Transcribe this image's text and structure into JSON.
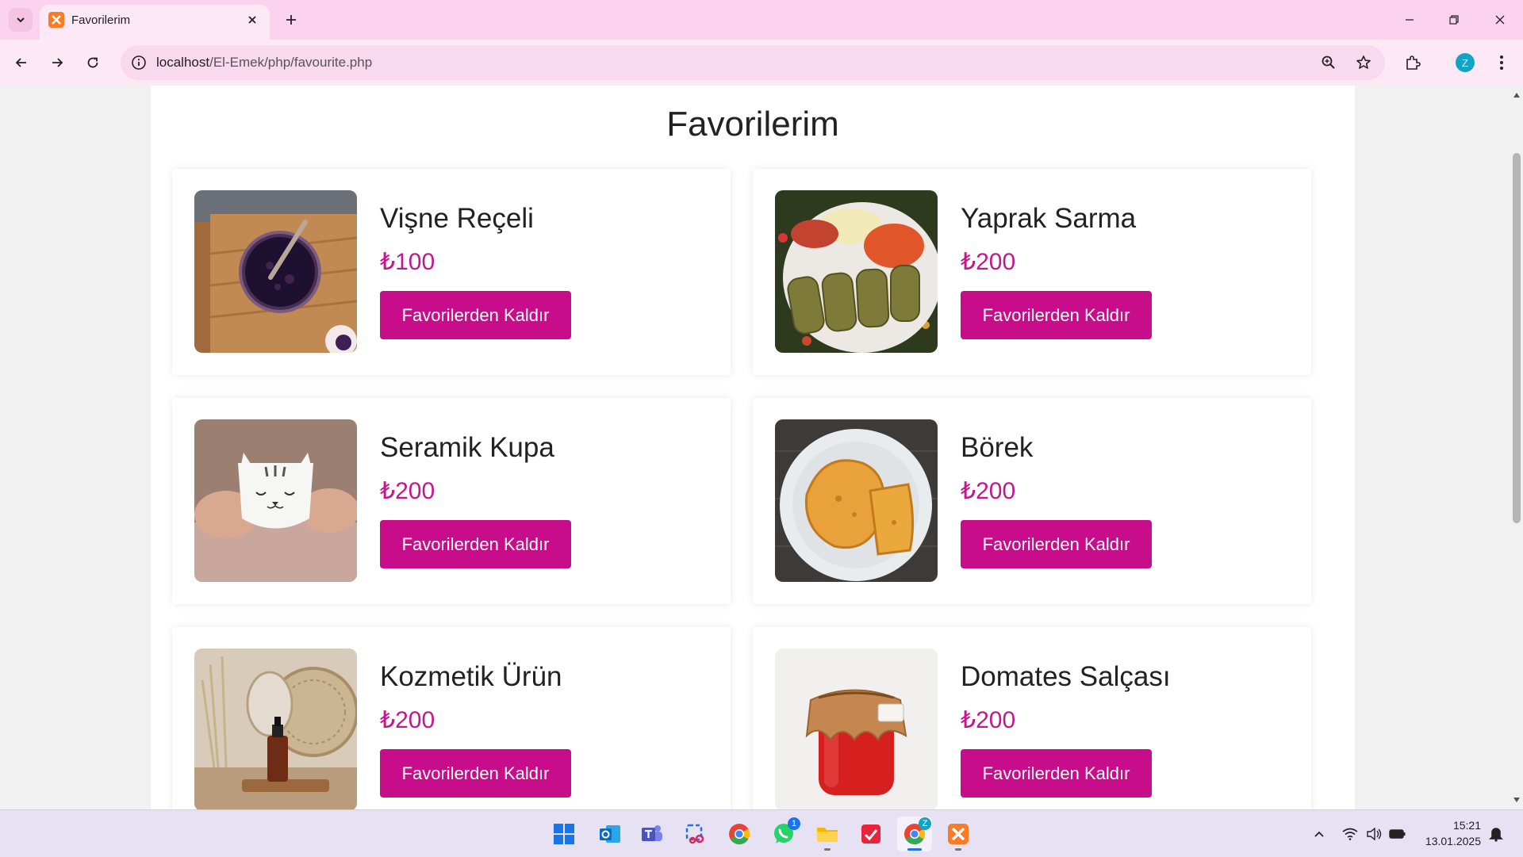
{
  "browser": {
    "tab_title": "Favorilerim",
    "url_host": "localhost",
    "url_path": "/El-Emek/php/favourite.php",
    "profile_initial": "Z"
  },
  "page": {
    "title": "Favorilerim",
    "products": [
      {
        "name": "Vişne Reçeli",
        "price": "₺100",
        "button": "Favorilerden Kaldır",
        "image": "cherry-jam-photo"
      },
      {
        "name": "Yaprak Sarma",
        "price": "₺200",
        "button": "Favorilerden Kaldır",
        "image": "stuffed-grape-leaves-photo"
      },
      {
        "name": "Seramik Kupa",
        "price": "₺200",
        "button": "Favorilerden Kaldır",
        "image": "ceramic-cat-mug-photo"
      },
      {
        "name": "Börek",
        "price": "₺200",
        "button": "Favorilerden Kaldır",
        "image": "borek-pastry-photo"
      },
      {
        "name": "Kozmetik Ürün",
        "price": "₺200",
        "button": "Favorilerden Kaldır",
        "image": "cosmetic-bottle-photo"
      },
      {
        "name": "Domates Salçası",
        "price": "₺200",
        "button": "Favorilerden Kaldır",
        "image": "tomato-paste-jar-photo"
      }
    ]
  },
  "taskbar": {
    "time": "15:21",
    "date": "13.01.2025",
    "whatsapp_badge": "1",
    "chrome_badge": "Z"
  },
  "colors": {
    "accent": "#c70d8a",
    "price": "#c2188b",
    "tabbar": "#fcd3ee",
    "toolbar": "#fde8f5"
  }
}
